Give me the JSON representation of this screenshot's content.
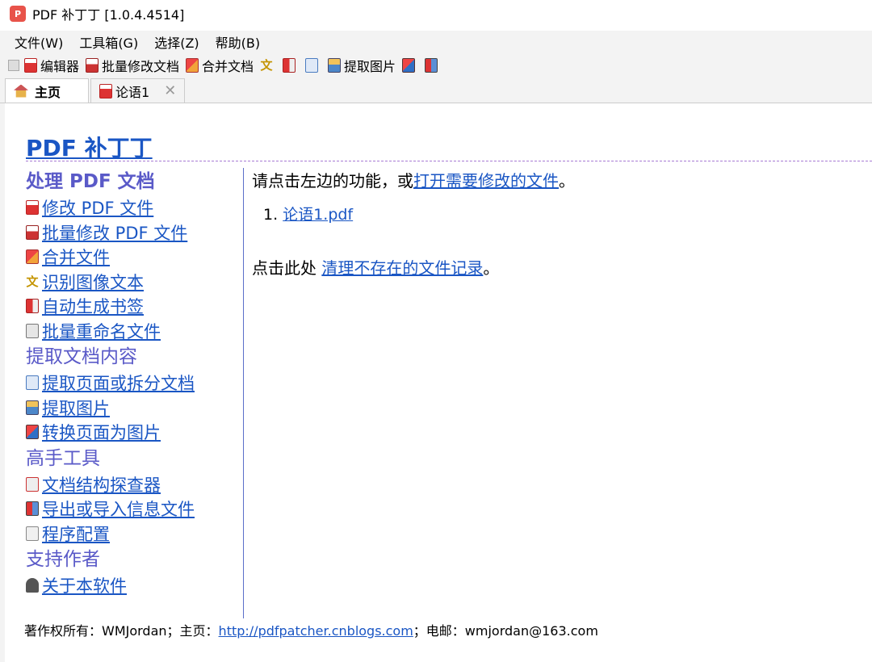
{
  "window": {
    "title": "PDF 补丁丁 [1.0.4.4514]"
  },
  "menu": [
    "文件(W)",
    "工具箱(G)",
    "选择(Z)",
    "帮助(B)"
  ],
  "toolbar": {
    "editor": "编辑器",
    "batch": "批量修改文档",
    "merge": "合并文档",
    "extract_images": "提取图片"
  },
  "tabs": {
    "home": "主页",
    "doc": "论语1"
  },
  "brand": "PDF 补丁丁",
  "sections": {
    "process": "处理 PDF 文档",
    "extract": "提取文档内容",
    "advanced": "高手工具",
    "support": "支持作者"
  },
  "links": {
    "edit_pdf": "修改 PDF 文件",
    "batch_edit": "批量修改 PDF 文件",
    "merge_files": "合并文件",
    "ocr": "识别图像文本",
    "auto_bookmark": "自动生成书签",
    "batch_rename": "批量重命名文件",
    "extract_pages": "提取页面或拆分文档",
    "extract_images": "提取图片",
    "pages_to_images": "转换页面为图片",
    "inspector": "文档结构探查器",
    "import_export": "导出或导入信息文件",
    "settings": "程序配置",
    "about": "关于本软件"
  },
  "main": {
    "prompt_pre": "请点击左边的功能，或",
    "prompt_link": "打开需要修改的文件",
    "prompt_post": "。",
    "recent_index": "1.",
    "recent_file": "论语1.pdf",
    "clean_pre": "点击此处 ",
    "clean_link": "清理不存在的文件记录",
    "clean_post": "。"
  },
  "footer": {
    "pre": "著作权所有：WMJordan；主页：",
    "url": "http://pdfpatcher.cnblogs.com",
    "post": "；电邮：wmjordan@163.com"
  }
}
